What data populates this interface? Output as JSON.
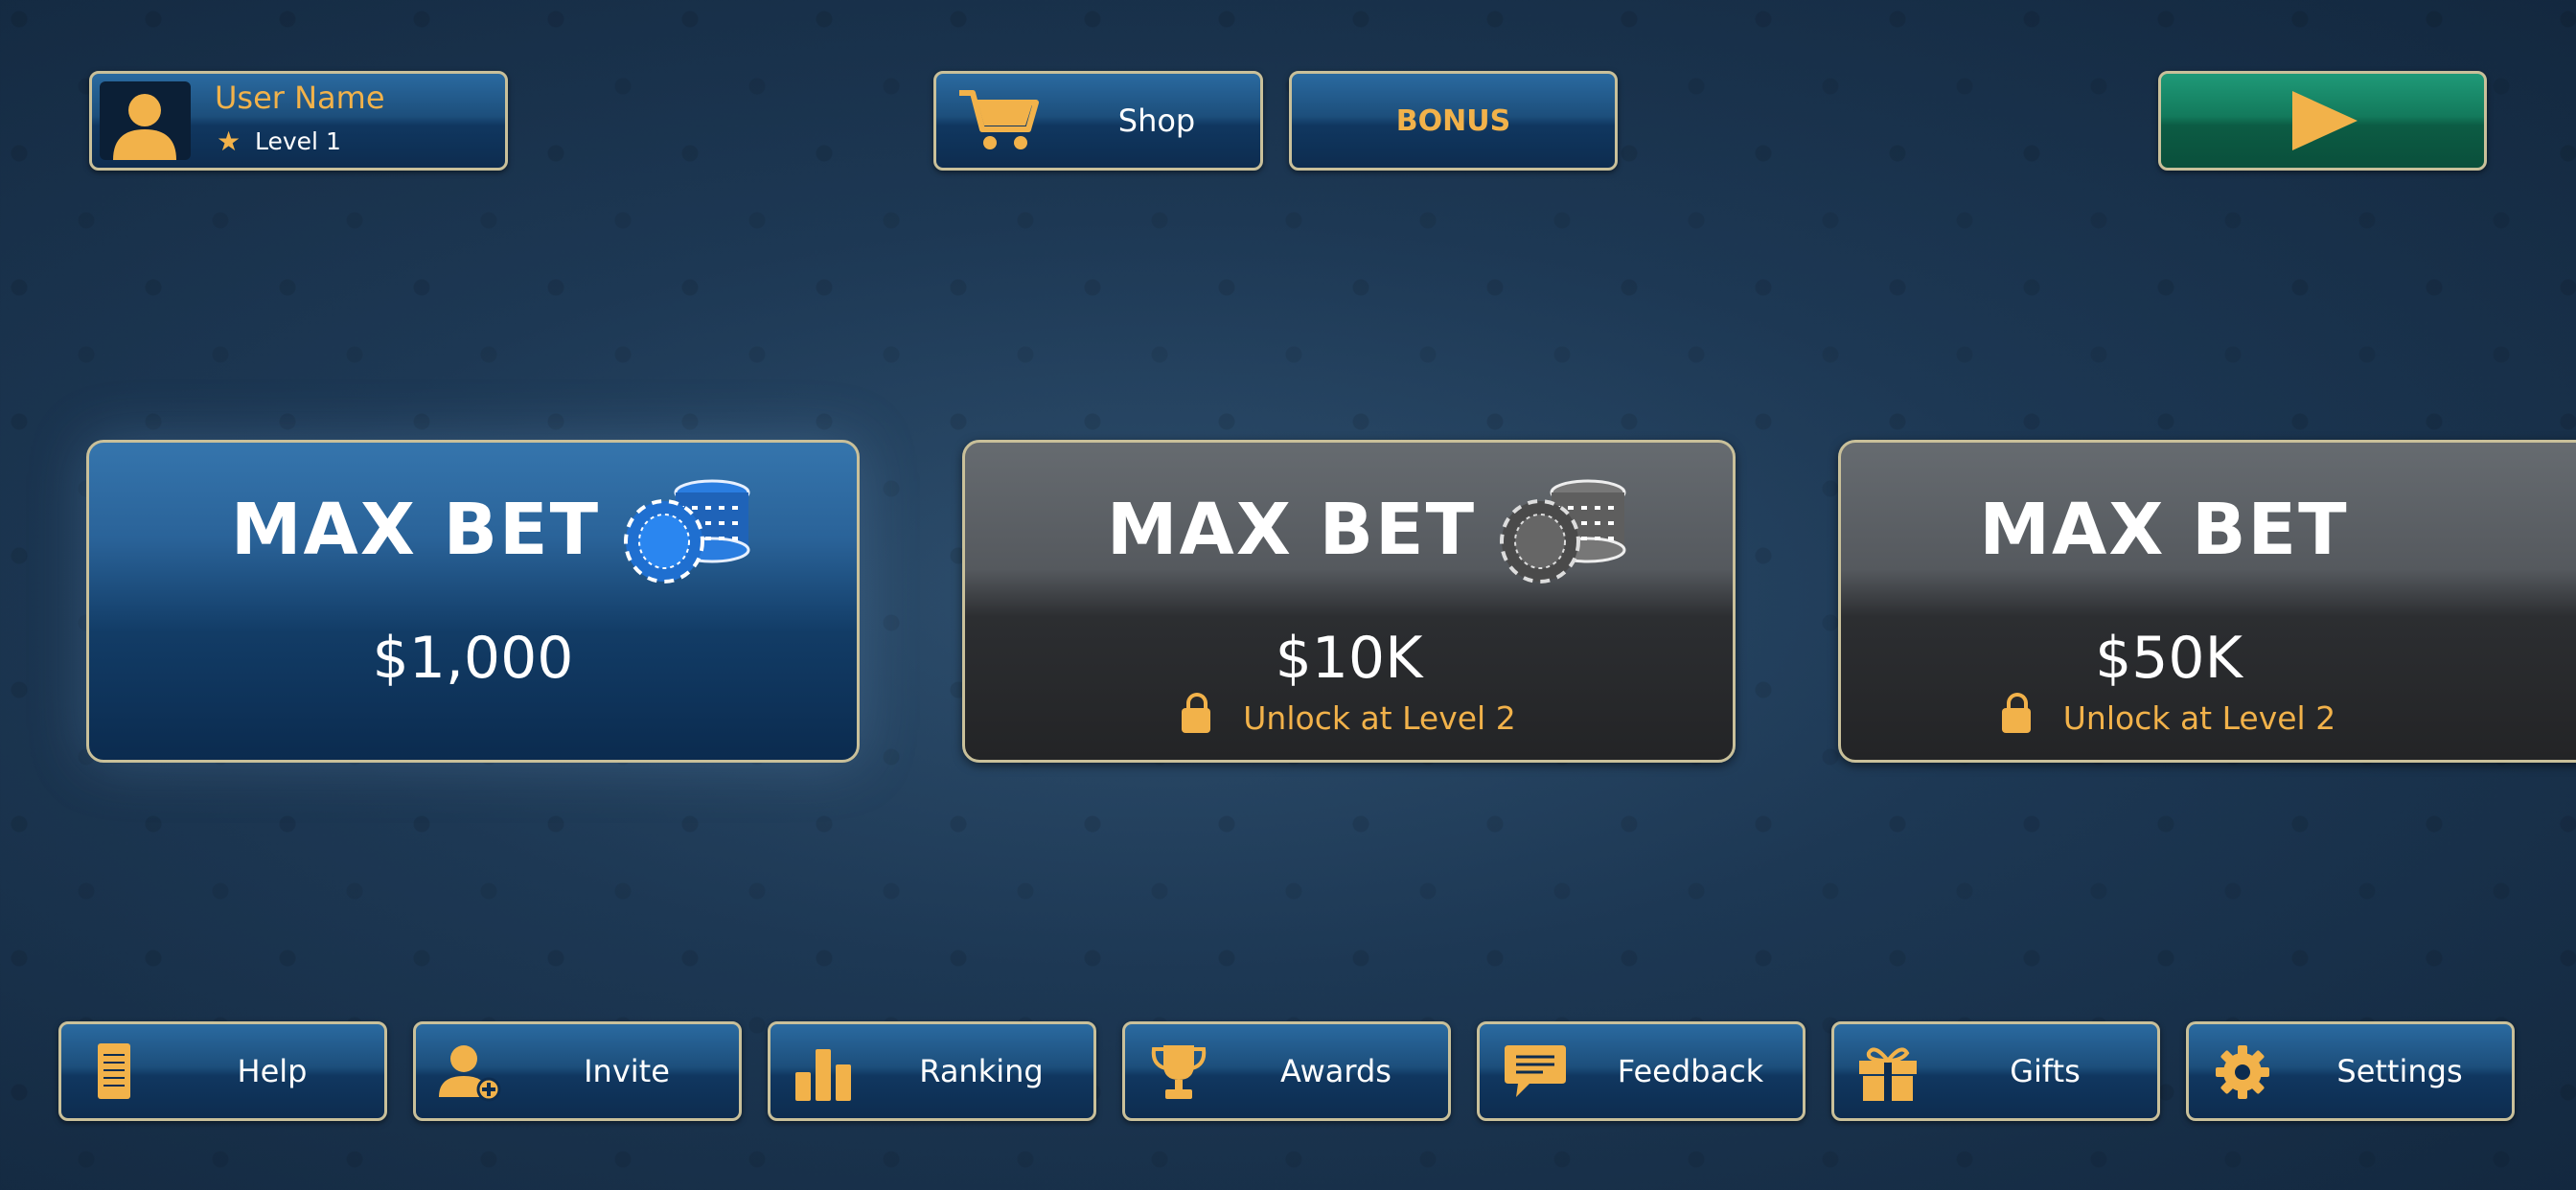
{
  "colors": {
    "accent": "#f2b24a",
    "panel_blue": "#1d4f7c",
    "play_green": "#137a5c",
    "locked_gray": "#55595e",
    "border_gold": "#c9c09a"
  },
  "user": {
    "name": "User Name",
    "level": "Level 1"
  },
  "top": {
    "shop_label": "Shop",
    "bonus_label": "BONUS",
    "play_icon": "play-icon"
  },
  "cards": [
    {
      "title": "MAX BET",
      "amount": "$1,000",
      "locked": false,
      "chips": "blue"
    },
    {
      "title": "MAX BET",
      "amount": "$10K",
      "locked": true,
      "unlock": "Unlock at Level 2",
      "chips": "gray"
    },
    {
      "title": "MAX BET",
      "amount": "$50K",
      "locked": true,
      "unlock": "Unlock at Level 2"
    }
  ],
  "bottom": {
    "help": "Help",
    "invite": "Invite",
    "ranking": "Ranking",
    "awards": "Awards",
    "feedback": "Feedback",
    "gifts": "Gifts",
    "settings": "Settings"
  }
}
